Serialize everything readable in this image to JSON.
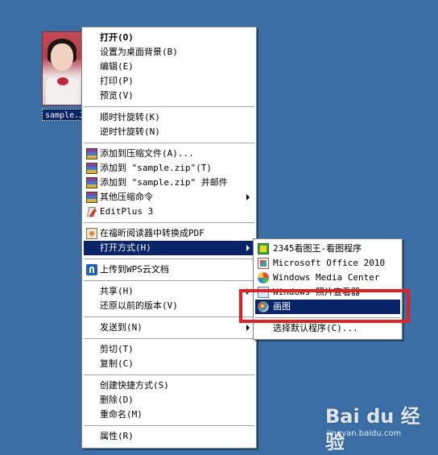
{
  "desktop": {
    "background_color": "#3a6ea5",
    "file": {
      "label": "sample.J"
    }
  },
  "context_menu": {
    "items": [
      {
        "label": "打开(O)",
        "bold": true
      },
      {
        "label": "设置为桌面背景(B)"
      },
      {
        "label": "编辑(E)"
      },
      {
        "label": "打印(P)"
      },
      {
        "label": "预览(V)"
      },
      {
        "label": "顺时针旋转(K)"
      },
      {
        "label": "逆时针旋转(N)"
      },
      {
        "label": "添加到压缩文件(A)...",
        "icon": "winrar-icon"
      },
      {
        "label": "添加到 \"sample.zip\"(T)",
        "icon": "winrar-icon"
      },
      {
        "label": "添加到 \"sample.zip\" 并邮件",
        "icon": "winrar-icon"
      },
      {
        "label": "其他压缩命令",
        "icon": "winrar-icon",
        "submenu": true
      },
      {
        "label": "EditPlus 3",
        "icon": "editplus-icon"
      },
      {
        "label": "在福昕阅读器中转换成PDF",
        "icon": "foxit-icon"
      },
      {
        "label": "打开方式(H)",
        "submenu": true,
        "highlighted": true
      },
      {
        "label": "上传到WPS云文档",
        "icon": "wps-icon"
      },
      {
        "label": "共享(H)",
        "submenu": true
      },
      {
        "label": "还原以前的版本(V)"
      },
      {
        "label": "发送到(N)",
        "submenu": true
      },
      {
        "label": "剪切(T)"
      },
      {
        "label": "复制(C)"
      },
      {
        "label": "创建快捷方式(S)"
      },
      {
        "label": "删除(D)"
      },
      {
        "label": "重命名(M)"
      },
      {
        "label": "属性(R)"
      }
    ]
  },
  "open_with_submenu": {
    "items": [
      {
        "label": "2345看图王-看图程序",
        "icon": "2345-viewer-icon"
      },
      {
        "label": "Microsoft Office 2010",
        "icon": "office-icon"
      },
      {
        "label": "Windows Media Center",
        "icon": "media-center-icon"
      },
      {
        "label": "Windows 照片查看器",
        "icon": "photo-viewer-icon"
      },
      {
        "label": "画图",
        "icon": "paint-icon",
        "highlighted": true
      },
      {
        "label": "选择默认程序(C)..."
      }
    ]
  },
  "annotation": {
    "color": "#e52020"
  },
  "watermark": {
    "logo": "Bai du 经验",
    "url": "jingyan.baidu.com"
  },
  "colors": {
    "highlight": "#0a246a",
    "menu_bg": "#ffffff"
  }
}
